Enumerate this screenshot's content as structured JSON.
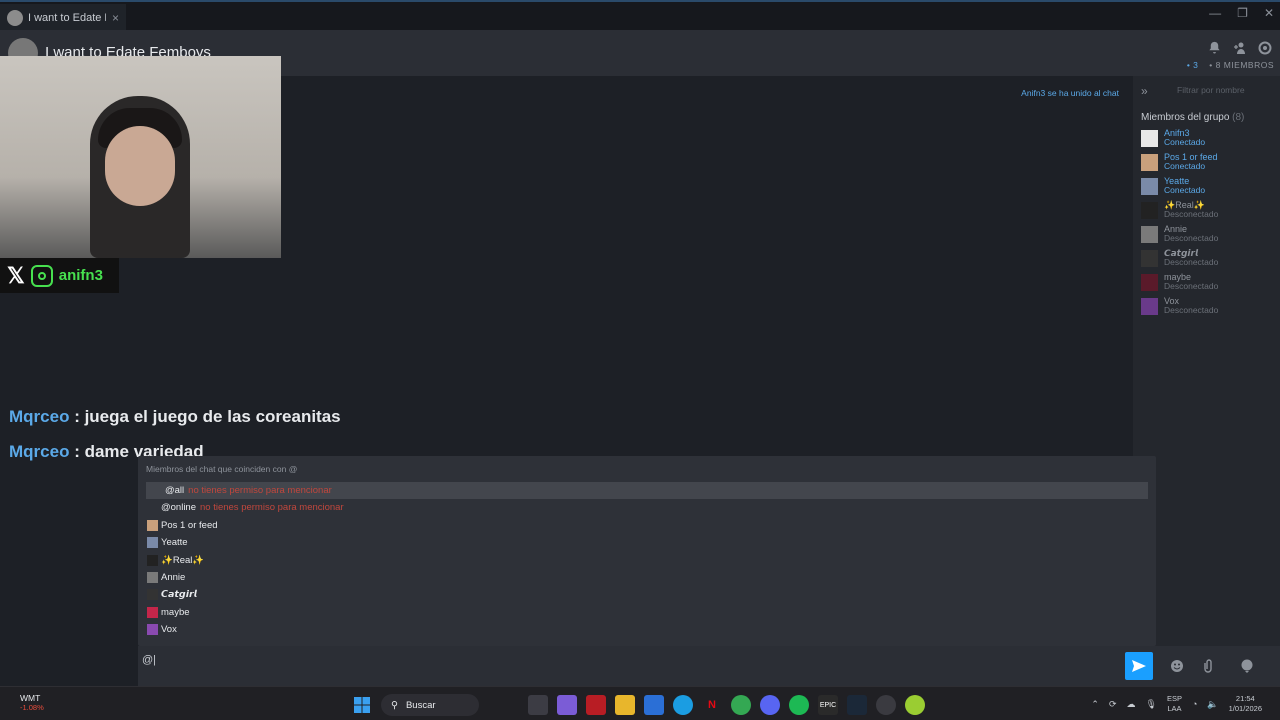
{
  "window": {
    "tab_title": "I want to Edate Fe",
    "tab_close": "×",
    "minimize": "—",
    "maximize": "❐",
    "close": "✕"
  },
  "header": {
    "group_title": "I want to Edate Femboys",
    "online_count": "• 3",
    "members_count": "• 8 MIEMBROS"
  },
  "overlay": {
    "social_handle": "anifn3",
    "x_glyph": "𝕏"
  },
  "chat": {
    "system_message": "Anifn3 se ha unido al chat",
    "messages": [
      {
        "nick": "Mqrceo",
        "sep": " : ",
        "text": "juega el juego de las coreanitas"
      },
      {
        "nick": "Mqrceo",
        "sep": " : ",
        "text": "dame variedad"
      }
    ]
  },
  "sidebar": {
    "filter_placeholder": "Filtrar por nombre",
    "section_title": "Miembros del grupo",
    "section_count": "(8)",
    "members": [
      {
        "name": "Anifn3",
        "status": "Conectado",
        "color": "#e8e8e8"
      },
      {
        "name": "Pos 1 or feed",
        "status": "Conectado",
        "color": "#c9a07c"
      },
      {
        "name": "Yeatte",
        "status": "Conectado",
        "color": "#7a8aa8"
      },
      {
        "name": "✨Real✨",
        "status": "Desconectado",
        "color": "#222222"
      },
      {
        "name": "Annie",
        "status": "Desconectado",
        "color": "#7a7a7a"
      },
      {
        "name": "𝘾𝙖𝙩𝙜𝙞𝙧𝙡",
        "status": "Desconectado",
        "color": "#333333"
      },
      {
        "name": "maybe",
        "status": "Desconectado",
        "color": "#5a1a2a"
      },
      {
        "name": "Vox",
        "status": "Desconectado",
        "color": "#6a3a8a"
      }
    ]
  },
  "mention_popup": {
    "header": "Miembros del chat que coinciden con @",
    "special": [
      {
        "label": "@all",
        "error": "no tienes permiso para mencionar"
      },
      {
        "label": "@online",
        "error": "no tienes permiso para mencionar"
      }
    ],
    "members": [
      {
        "name": "Pos 1 or feed",
        "color": "#c9a07c"
      },
      {
        "name": "Yeatte",
        "color": "#7a8aa8"
      },
      {
        "name": "✨Real✨",
        "color": "#222222"
      },
      {
        "name": "Annie",
        "color": "#7a7a7a"
      },
      {
        "name": "𝘾𝙖𝙩𝙜𝙞𝙧𝙡",
        "color": "#333333"
      },
      {
        "name": "maybe",
        "color": "#c4264a"
      },
      {
        "name": "Vox",
        "color": "#8a4ab0"
      }
    ]
  },
  "input": {
    "value": "@|"
  },
  "taskbar": {
    "stock_symbol": "WMT",
    "stock_change": "-1.08%",
    "search_label": "Buscar",
    "lang_line1": "ESP",
    "lang_line2": "LAA",
    "time": "21:54",
    "date": "1/01/2026"
  },
  "colors": {
    "accent": "#5ba9e8",
    "send_button": "#1a9fff",
    "error": "#c0473d",
    "social_green": "#47e04f"
  }
}
